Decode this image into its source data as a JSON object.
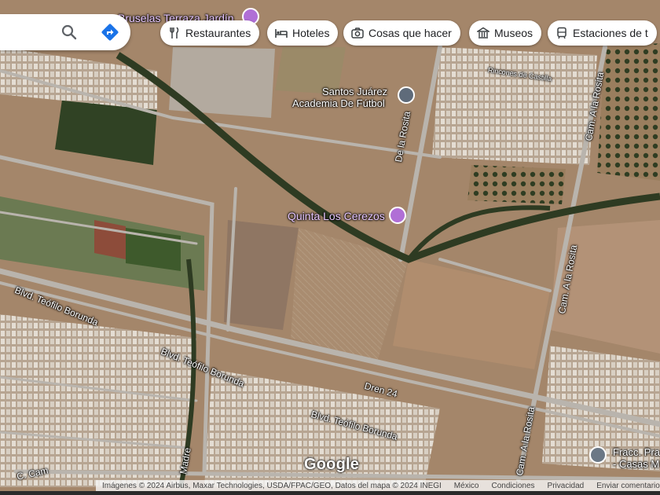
{
  "search": {
    "search_icon": "search-icon",
    "directions_icon": "directions-icon"
  },
  "chips": [
    {
      "label": "Restaurantes",
      "icon": "restaurant-icon"
    },
    {
      "label": "Hoteles",
      "icon": "hotel-icon"
    },
    {
      "label": "Cosas que hacer",
      "icon": "camera-icon"
    },
    {
      "label": "Museos",
      "icon": "museum-icon"
    },
    {
      "label": "Estaciones de t",
      "icon": "transit-icon"
    }
  ],
  "places": {
    "bruselas": "Bruselas Terraza Jardín",
    "santos_line1": "Santos Juárez",
    "santos_line2": "Academia De Fútbol",
    "quinta": "Quinta Los Cerezos",
    "fracc_line1": "Fracc. Pra",
    "fracc_line2": "- Casas M"
  },
  "roads": {
    "de_la_rosita": "De la Rosita",
    "cam_a_la_rosita_1": "Cam. A la Rosita",
    "cam_a_la_rosita_2": "Cam. A la Rosita",
    "cam_a_la_rosita_3": "Cam. A la Rosita",
    "blvd_1": "Blvd. Teófilo Borunda",
    "blvd_2": "Blvd. Teófilo Borunda",
    "blvd_3": "Blvd. Teófilo Borunda",
    "dren": "Dren 24",
    "madre": "Madre",
    "c_cam": "C. Cam",
    "rincones": "Rincones de Castilla"
  },
  "brand": "Google",
  "attribution": {
    "credits": "Imágenes © 2024 Airbus, Maxar Technologies, USDA/FPAC/GEO, Datos del mapa © 2024 INEGI",
    "region": "México",
    "terms": "Condiciones",
    "privacy": "Privacidad",
    "feedback": "Enviar comentarios"
  },
  "colors": {
    "poi_purple": "#b06fd6",
    "directions_blue": "#1a73e8",
    "land": "#a88a6c",
    "road": "#b9b4ad",
    "trees": "#3b4a2a"
  }
}
